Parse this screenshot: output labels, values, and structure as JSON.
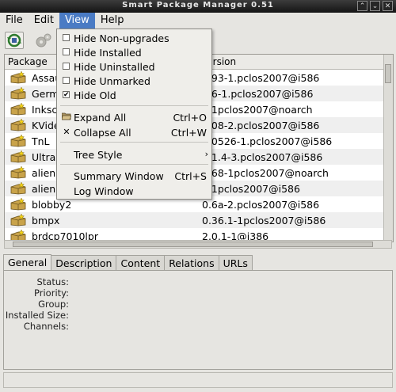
{
  "window": {
    "title": "Smart Package Manager 0.51",
    "controls": [
      "⌃",
      "⌄",
      "✕"
    ]
  },
  "menubar": {
    "items": [
      "File",
      "Edit",
      "View",
      "Help"
    ],
    "active": "View"
  },
  "list": {
    "columns": {
      "package": "Package",
      "version": "Version"
    },
    "rows": [
      {
        "name": "Assault",
        "version": "0.93-1.pclos2007@i586"
      },
      {
        "name": "Germ",
        "version": "0.6-1.pclos2007@i586"
      },
      {
        "name": "Inkscape",
        "version": "0.1pclos2007@noarch"
      },
      {
        "name": "KVideo",
        "version": "0.08-2.pclos2007@i586"
      },
      {
        "name": "TnL",
        "version": "0.0526-1.pclos2007@i586"
      },
      {
        "name": "UltraStar",
        "version": "0.1.4-3.pclos2007@i586"
      },
      {
        "name": "alien",
        "version": "8.68-1pclos2007@noarch"
      },
      {
        "name": "alienblaster",
        "version": "1.1pclos2007@i586"
      },
      {
        "name": "blobby2",
        "version": "0.6a-2.pclos2007@i586"
      },
      {
        "name": "bmpx",
        "version": "0.36.1-1pclos2007@i586"
      },
      {
        "name": "brdcp7010lpr",
        "version": "2.0.1-1@i386"
      }
    ]
  },
  "view_menu": {
    "filters": [
      {
        "label": "Hide Non-upgrades",
        "checked": false
      },
      {
        "label": "Hide Installed",
        "checked": false
      },
      {
        "label": "Hide Uninstalled",
        "checked": false
      },
      {
        "label": "Hide Unmarked",
        "checked": false
      },
      {
        "label": "Hide Old",
        "checked": true
      }
    ],
    "expand_all": {
      "label": "Expand All",
      "accel": "Ctrl+O"
    },
    "collapse_all": {
      "label": "Collapse All",
      "accel": "Ctrl+W"
    },
    "tree_style": {
      "label": "Tree Style"
    },
    "summary_window": {
      "label": "Summary Window",
      "accel": "Ctrl+S"
    },
    "log_window": {
      "label": "Log Window"
    }
  },
  "tabs": [
    "General",
    "Description",
    "Content",
    "Relations",
    "URLs"
  ],
  "general": {
    "fields": [
      "Status:",
      "Priority:",
      "Group:",
      "Installed Size:",
      "Channels:"
    ]
  },
  "colors": {
    "menu_highlight": "#4a7bc4",
    "window_bg": "#e6e5e1"
  }
}
